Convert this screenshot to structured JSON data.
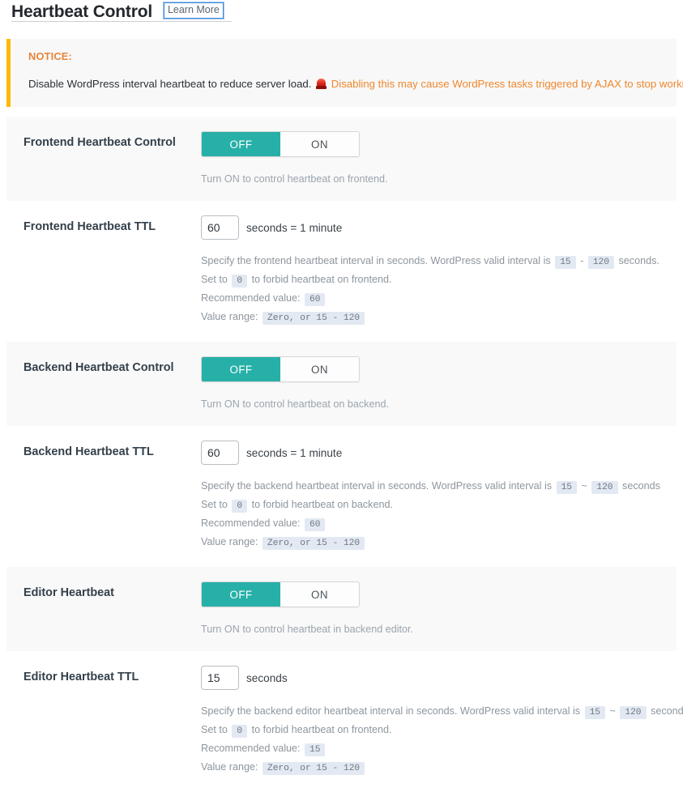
{
  "header": {
    "title": "Heartbeat Control",
    "learn_more_label": "Learn More"
  },
  "notice": {
    "label": "NOTICE:",
    "icon": "siren-icon",
    "text_before": "Disable WordPress interval heartbeat to reduce server load.",
    "warning_text": "Disabling this may cause WordPress tasks triggered by AJAX to stop working.",
    "border_color": "#ffb900",
    "warning_color": "#f0872b",
    "label_color": "#e8853a"
  },
  "accent_color": "#27b0a8",
  "badge_bg_color": "#e3e9f2",
  "rows": [
    {
      "name": "frontend-heartbeat-control",
      "label": "Frontend Heartbeat Control",
      "type": "toggle",
      "shaded": true,
      "off_label": "OFF",
      "on_label": "ON",
      "state": "OFF",
      "help": "Turn ON to control heartbeat on frontend."
    },
    {
      "name": "frontend-heartbeat-ttl",
      "label": "Frontend Heartbeat TTL",
      "type": "ttl",
      "shaded": false,
      "value": "60",
      "suffix": "seconds = 1 minute",
      "desc": {
        "line1_a": "Specify the frontend heartbeat interval in seconds. WordPress valid interval is",
        "line1_min": "15",
        "line1_sep": "-",
        "line1_max": "120",
        "line1_b": "seconds.",
        "line2_a": "Set to",
        "line2_code": "0",
        "line2_b": "to forbid heartbeat on frontend.",
        "line3_a": "Recommended value:",
        "line3_code": "60",
        "line4_a": "Value range:",
        "line4_code": "Zero, or 15 - 120"
      }
    },
    {
      "name": "backend-heartbeat-control",
      "label": "Backend Heartbeat Control",
      "type": "toggle",
      "shaded": true,
      "off_label": "OFF",
      "on_label": "ON",
      "state": "OFF",
      "help": "Turn ON to control heartbeat on backend."
    },
    {
      "name": "backend-heartbeat-ttl",
      "label": "Backend Heartbeat TTL",
      "type": "ttl",
      "shaded": false,
      "value": "60",
      "suffix": "seconds = 1 minute",
      "desc": {
        "line1_a": "Specify the backend heartbeat interval in seconds. WordPress valid interval is",
        "line1_min": "15",
        "line1_sep": "~",
        "line1_max": "120",
        "line1_b": "seconds",
        "line2_a": "Set to",
        "line2_code": "0",
        "line2_b": "to forbid heartbeat on backend.",
        "line3_a": "Recommended value:",
        "line3_code": "60",
        "line4_a": "Value range:",
        "line4_code": "Zero, or 15 - 120"
      }
    },
    {
      "name": "editor-heartbeat",
      "label": "Editor Heartbeat",
      "type": "toggle",
      "shaded": true,
      "off_label": "OFF",
      "on_label": "ON",
      "state": "OFF",
      "help": "Turn ON to control heartbeat in backend editor."
    },
    {
      "name": "editor-heartbeat-ttl",
      "label": "Editor Heartbeat TTL",
      "type": "ttl",
      "shaded": false,
      "value": "15",
      "suffix": "seconds",
      "desc": {
        "line1_a": "Specify the backend editor heartbeat interval in seconds. WordPress valid interval is",
        "line1_min": "15",
        "line1_sep": "~",
        "line1_max": "120",
        "line1_b": "seconds",
        "line2_a": "Set to",
        "line2_code": "0",
        "line2_b": "to forbid heartbeat on frontend.",
        "line3_a": "Recommended value:",
        "line3_code": "15",
        "line4_a": "Value range:",
        "line4_code": "Zero, or 15 - 120"
      }
    }
  ]
}
